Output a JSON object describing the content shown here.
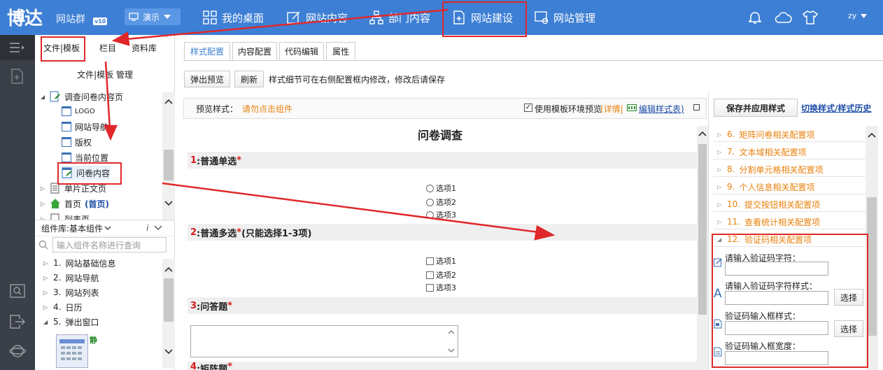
{
  "brand": {
    "name": "博达",
    "sub": "网站群",
    "version": "v10"
  },
  "demo_select": {
    "value": "演示"
  },
  "topnav": [
    {
      "label": "我的桌面",
      "icon": "dashboard-grid-icon"
    },
    {
      "label": "网站内容",
      "icon": "edit-icon"
    },
    {
      "label": "部门内容",
      "icon": "org-chart-icon"
    },
    {
      "label": "网站建设",
      "icon": "page-add-icon"
    },
    {
      "label": "网站管理",
      "icon": "site-settings-icon"
    }
  ],
  "user": {
    "name": "zy"
  },
  "left_tabs": [
    "文件|模板",
    "栏目",
    "资料库"
  ],
  "left_title": "文件|模板 管理",
  "tree": [
    {
      "label": "调查问卷内容页",
      "level": 0
    },
    {
      "label": "LOGO",
      "level": 1
    },
    {
      "label": "网站导航",
      "level": 1
    },
    {
      "label": "版权",
      "level": 1
    },
    {
      "label": "当前位置",
      "level": 1
    },
    {
      "label": "问卷内容",
      "level": 1
    },
    {
      "label": "单片正文页",
      "level": 0
    },
    {
      "label": "首页",
      "suffix": "(首页)",
      "level": 0
    },
    {
      "label": "列表页",
      "level": 0
    }
  ],
  "component_lib": {
    "label": "组件库:",
    "value": "基本组件"
  },
  "component_search": {
    "placeholder": "输入组件名称进行查询"
  },
  "components": [
    {
      "num": "1.",
      "label": "网站基础信息",
      "expanded": false
    },
    {
      "num": "2.",
      "label": "网站导航",
      "expanded": false
    },
    {
      "num": "3.",
      "label": "网站列表",
      "expanded": false
    },
    {
      "num": "4.",
      "label": "日历",
      "expanded": false
    },
    {
      "num": "5.",
      "label": "弹出窗口",
      "expanded": true
    }
  ],
  "component_preview_label": "静",
  "center_tabs": [
    "样式配置",
    "内容配置",
    "代码编辑",
    "属性"
  ],
  "toolbar": {
    "popup_preview": "弹出预览",
    "refresh": "刷新",
    "hint": "样式细节可在右侧配置框内修改，修改后请保存"
  },
  "preview": {
    "label": "预览样式：",
    "value": "请勿点击组件",
    "use_env": "使用模板环境预览",
    "detail": "(详情|",
    "edit_styles": "编辑样式表)"
  },
  "survey": {
    "title": "问卷调查",
    "q1": {
      "num": "1",
      "label": ":普通单选",
      "star": "*",
      "options": [
        "选项1",
        "选项2",
        "选项3"
      ]
    },
    "q2": {
      "num": "2",
      "label": ":普通多选",
      "star": "*",
      "extra": "(只能选择1-3项)",
      "options": [
        "选项1",
        "选项2",
        "选项3"
      ]
    },
    "q3": {
      "num": "3",
      "label": ":问答题",
      "star": "*"
    },
    "q4": {
      "num": "4",
      "label": ":矩阵题",
      "star": "*"
    }
  },
  "right": {
    "save": "保存并应用样式",
    "history": "切换样式/样式历史",
    "items": [
      {
        "num": "6.",
        "label": "矩阵问卷相关配置项"
      },
      {
        "num": "7.",
        "label": "文本域相关配置项"
      },
      {
        "num": "8.",
        "label": "分割单元格相关配置项"
      },
      {
        "num": "9.",
        "label": "个人信息相关配置项"
      },
      {
        "num": "10.",
        "label": "提交按钮相关配置项"
      },
      {
        "num": "11.",
        "label": "查看统计相关配置项"
      },
      {
        "num": "12.",
        "label": "验证码相关配置项"
      }
    ],
    "fields": {
      "f1": "请输入验证码字符：",
      "f2": "请输入验证码字符样式：",
      "f3": "验证码输入框样式：",
      "f4": "验证码输入框宽度：",
      "choose": "选择"
    }
  },
  "colors": {
    "topbar": "#3d7fd4",
    "highlight": "#e0282a",
    "accent_orange": "#e8810d",
    "required_red": "#d81b1b"
  }
}
